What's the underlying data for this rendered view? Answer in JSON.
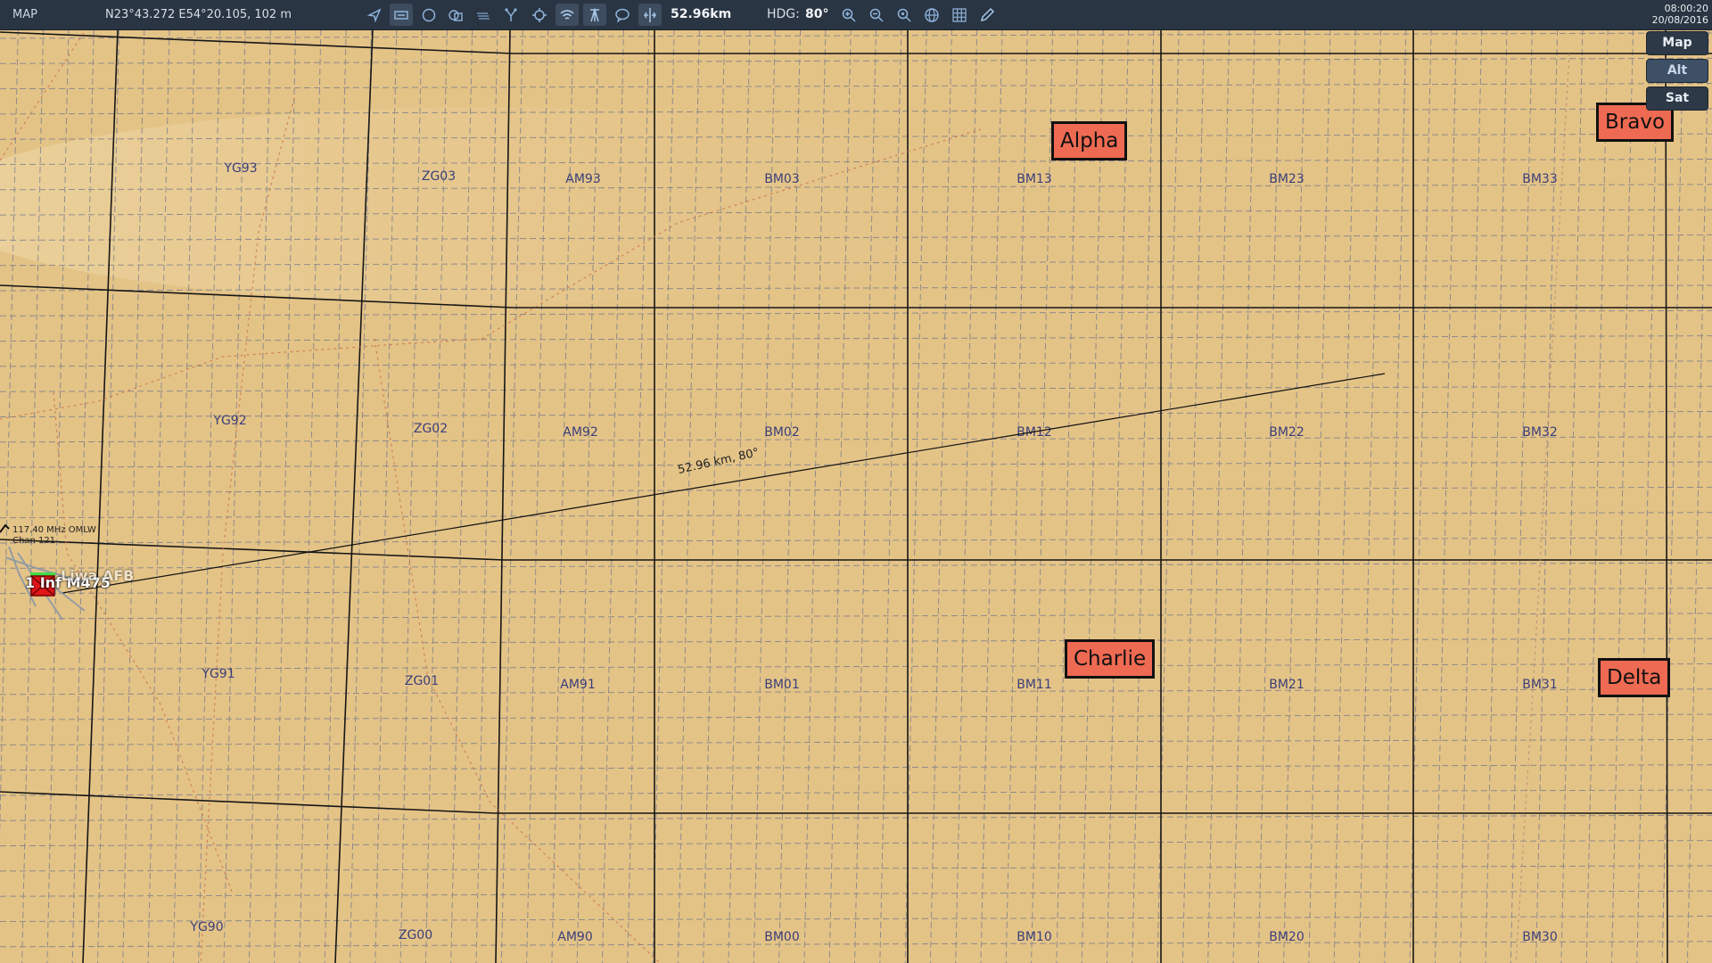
{
  "topbar": {
    "title": "MAP",
    "cursor_coords": "N23°43.272 E54°20.105, 102 m",
    "range": "52.96km",
    "hdg_label": "HDG:",
    "hdg_value": "80°",
    "clock_time": "08:00:20",
    "clock_date": "20/08/2016",
    "icons": [
      "navigate-icon",
      "unit-label-icon",
      "circle-icon",
      "layers-icon",
      "stack-icon",
      "route-icon",
      "crosshair-icon",
      "wifi-icon",
      "tower-icon",
      "chat-icon",
      "ruler-icon",
      "zoom-in-icon",
      "zoom-out-icon",
      "zoom-fit-icon",
      "globe-icon",
      "grid-icon",
      "pencil-icon"
    ]
  },
  "map_type": {
    "options": [
      "Map",
      "Alt",
      "Sat"
    ],
    "selected": "Alt"
  },
  "map": {
    "grid_labels": [
      "YG93",
      "ZG03",
      "AM93",
      "BM03",
      "BM13",
      "BM23",
      "BM33",
      "YG92",
      "ZG02",
      "AM92",
      "BM02",
      "BM12",
      "BM22",
      "BM32",
      "YG91",
      "ZG01",
      "AM91",
      "BM01",
      "BM11",
      "BM21",
      "BM31",
      "YG90",
      "ZG00",
      "AM90",
      "BM00",
      "BM10",
      "BM20",
      "BM30"
    ],
    "targets": [
      "Alpha",
      "Bravo",
      "Charlie",
      "Delta"
    ],
    "measure_label": "52.96 km, 80°",
    "tacan_line1": "117.40 MHz OMLW",
    "tacan_line2": "Chan 121",
    "unit_label": "1 Inf M475",
    "unit_label_overlap": "Liwa AFB"
  },
  "colors": {
    "map_bg": "#e4c387",
    "topbar_bg": "#2a3543",
    "target_fill": "#ee6a52",
    "grid_label": "#3a3f7a"
  }
}
